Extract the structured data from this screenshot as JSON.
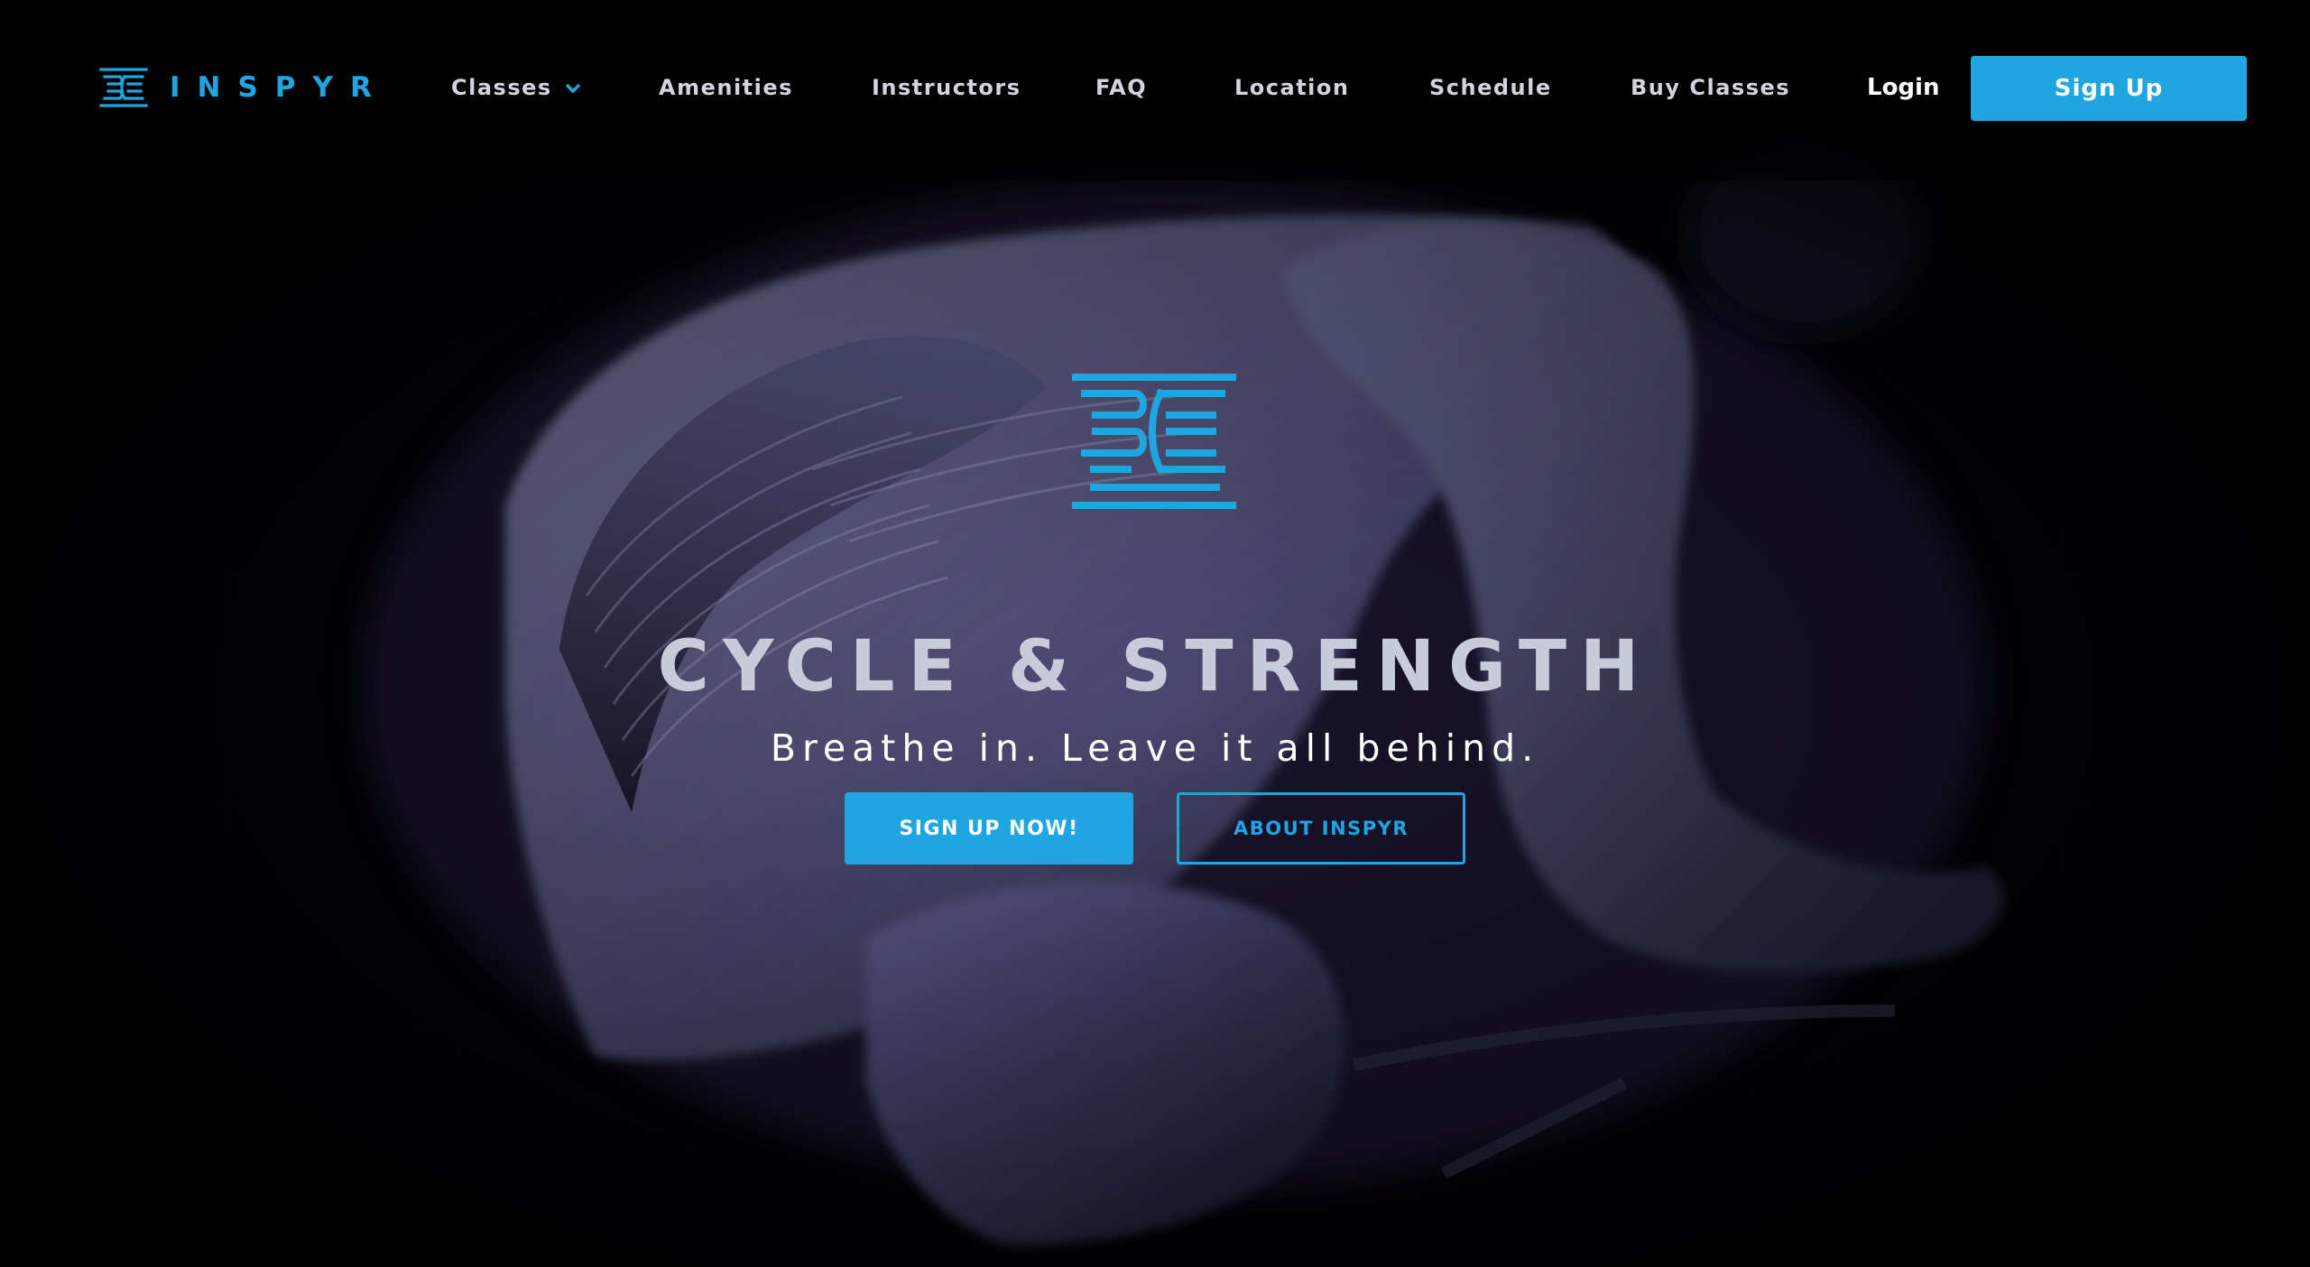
{
  "brand": {
    "name": "INSPYR",
    "logo_icon": "inspyr-logo-icon",
    "accent_color": "#1fa5df"
  },
  "nav": {
    "items": [
      {
        "label": "Classes",
        "has_dropdown": true
      },
      {
        "label": "Amenities"
      },
      {
        "label": "Instructors"
      },
      {
        "label": "FAQ"
      },
      {
        "label": "Location"
      },
      {
        "label": "Schedule"
      },
      {
        "label": "Buy Classes"
      }
    ],
    "login_label": "Login",
    "signup_label": "Sign Up"
  },
  "hero": {
    "emblem_icon": "inspyr-emblem-icon",
    "title": "CYCLE & STRENGTH",
    "subtitle": "Breathe in. Leave it all behind.",
    "primary_cta": "SIGN UP NOW!",
    "secondary_cta": "ABOUT INSPYR",
    "background": "cyclist-photo"
  }
}
